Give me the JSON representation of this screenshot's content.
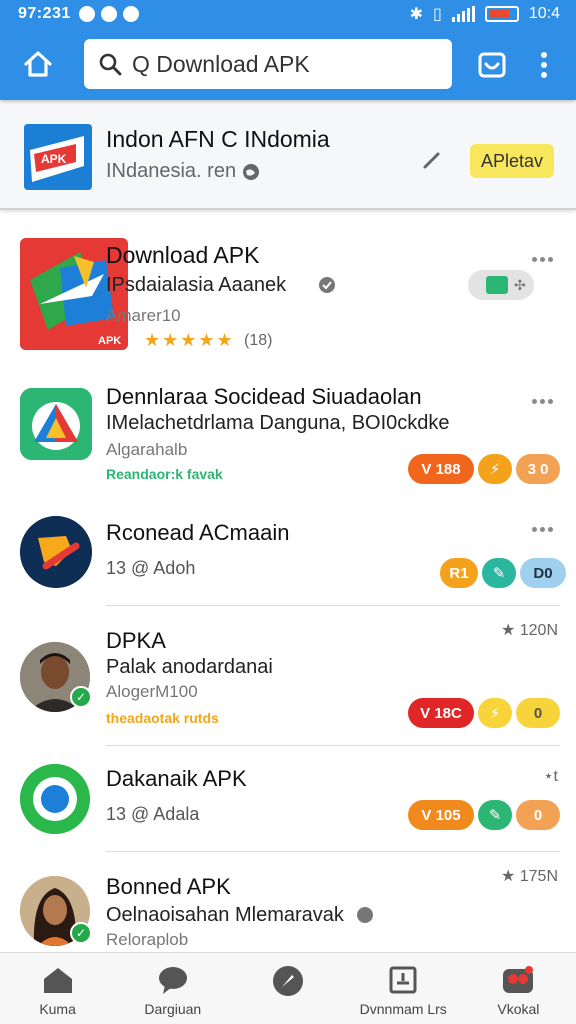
{
  "status": {
    "time": "97:231",
    "battery": "10:4"
  },
  "search": {
    "placeholder": "Q  Download APK",
    "value": "Download APK"
  },
  "featured": {
    "title": "Indon AFN C INdomia",
    "subtitle": "INdanesia. ren",
    "button": "APletav"
  },
  "apps": [
    {
      "title": "Download APK",
      "line2": "IPsdaialasia Aaanek",
      "line3": "Amarer10",
      "rating": "(18)",
      "stars": 5
    },
    {
      "title": "Dennlaraa Socidead Siuadaolan",
      "line2": "IMelachetdrlama Danguna, BOI0ckdke",
      "line3": "Algarahalb",
      "tags": "Reandaor:k favak",
      "pills": [
        "V 188",
        "⚡",
        "3 0"
      ]
    },
    {
      "title": "Rconead ACmaain",
      "line2": "13 @ Adoh",
      "pills": [
        "R1",
        "✎",
        "D0"
      ]
    },
    {
      "title": "DPKA",
      "line2": "Palak anodardanai",
      "line3": "AlogerM100",
      "tags": "theadaotak rutds",
      "rating": "★ 120N",
      "pills": [
        "V 18C",
        "⚡",
        "0"
      ]
    },
    {
      "title": "Dakanaik APK",
      "line2": "13 @ Adala",
      "rating": "⋆t",
      "pills": [
        "V 105",
        "✎",
        "0"
      ]
    },
    {
      "title": "Bonned APK",
      "line2": "Oelnaoisahan Mlemaravak",
      "line3": "Reloraplob",
      "rating": "★ 175N"
    }
  ],
  "nav": [
    {
      "label": "Kuma",
      "icon": "home-icon"
    },
    {
      "label": "Dargiuan",
      "icon": "chat-bubble-icon"
    },
    {
      "label": "",
      "icon": "compass-icon"
    },
    {
      "label": "Dvnnmam Lrs",
      "icon": "downloads-box-icon"
    },
    {
      "label": "Vkokal",
      "icon": "users-badge-icon"
    }
  ],
  "colors": {
    "appbar": "#2f8fe6",
    "accent_yellow": "#f8e75c",
    "pill_orange": "#f08a1c",
    "pill_red": "#e53935",
    "pill_green": "#2bb673",
    "pill_blue": "#4aa3df"
  }
}
